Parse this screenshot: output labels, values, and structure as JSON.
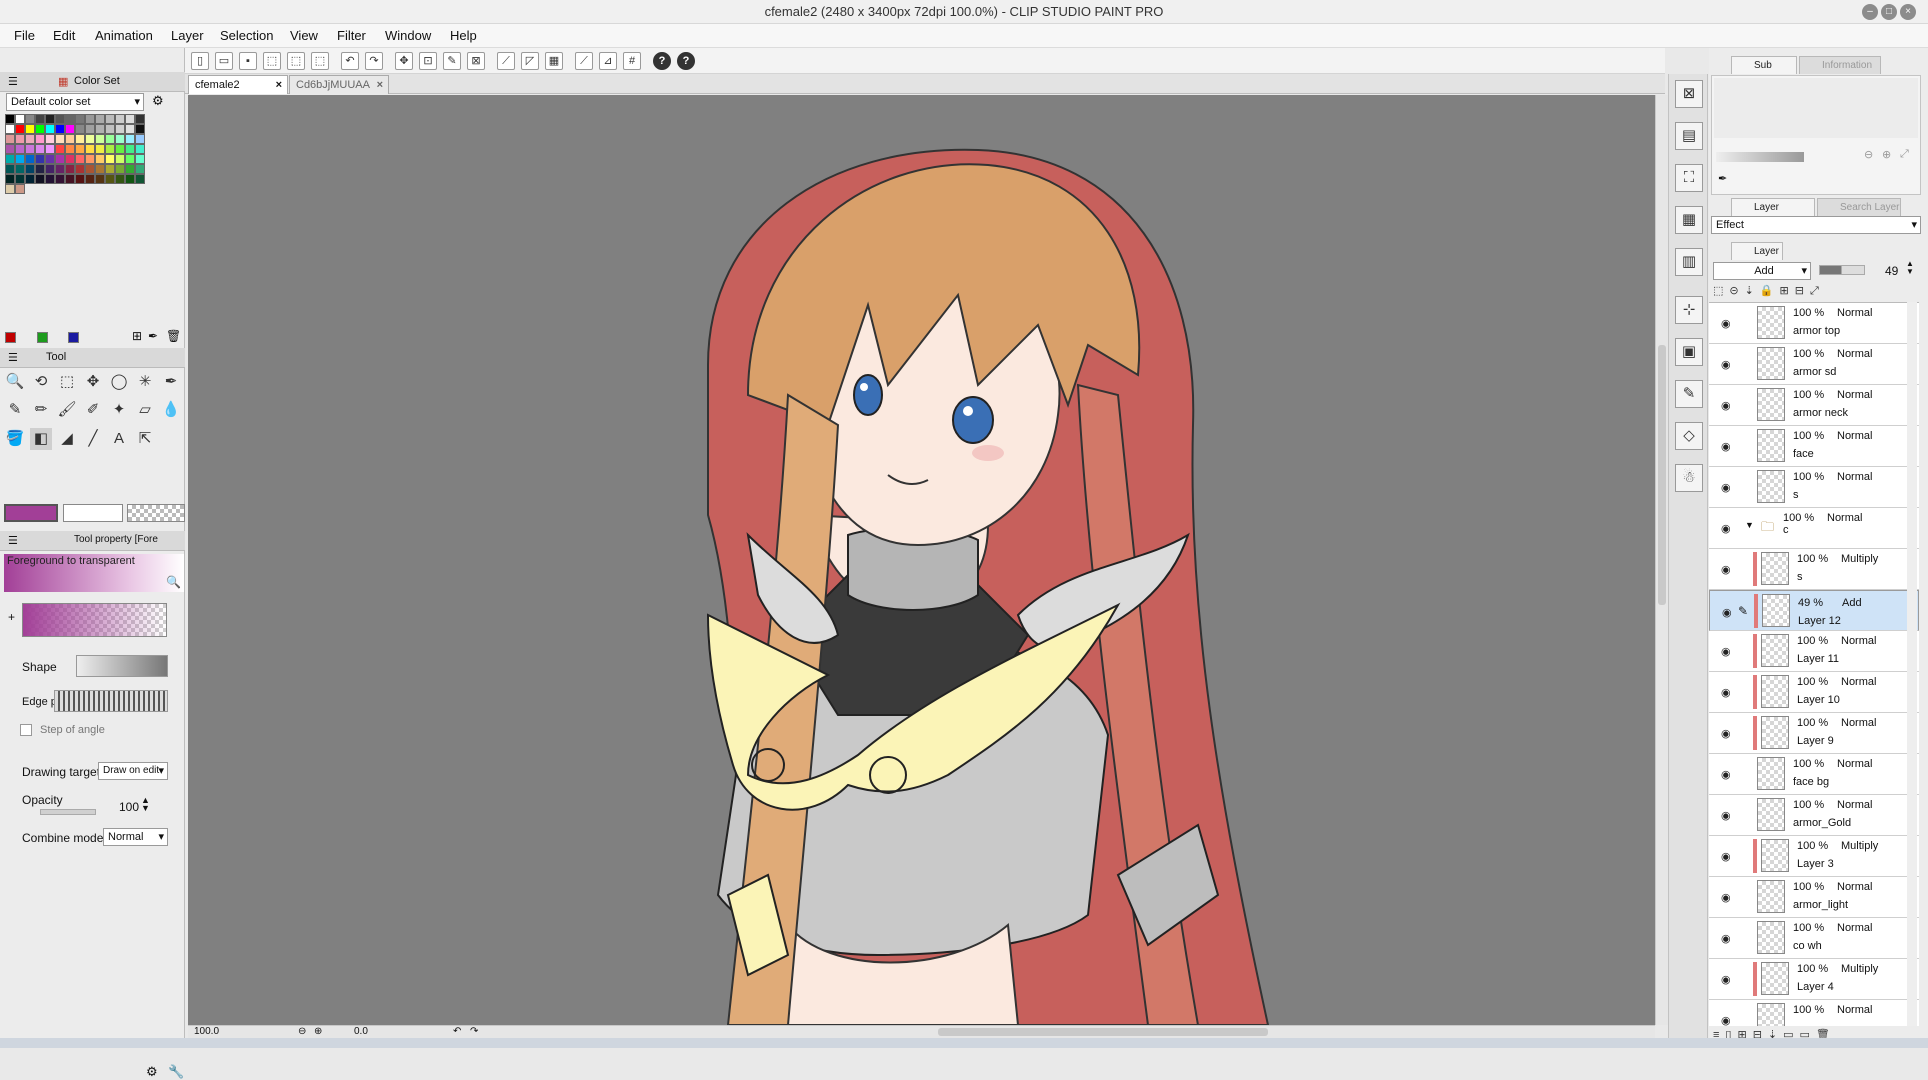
{
  "window": {
    "title": "cfemale2 (2480 x 3400px 72dpi 100.0%)  - CLIP STUDIO PAINT PRO",
    "controls": [
      "minimize-icon",
      "maximize-icon",
      "close-icon"
    ]
  },
  "menu": [
    "File",
    "Edit",
    "Animation",
    "Layer",
    "Selection",
    "View",
    "Filter",
    "Window",
    "Help"
  ],
  "document_tabs": [
    {
      "label": "cfemale2",
      "active": true
    },
    {
      "label": "Cd6bJjMUUAA",
      "active": false
    }
  ],
  "color_set": {
    "panel_title": "Color Set",
    "selected_set": "Default color set"
  },
  "tool_panel": {
    "title": "Tool"
  },
  "tool_property": {
    "title": "Tool property [Fore",
    "gradient_name": "Foreground to transparent",
    "shape_label": "Shape",
    "edge_label": "Edge p",
    "step_of_angle_label": "Step of angle",
    "drawing_target_label": "Drawing target",
    "drawing_target_value": "Draw on edit",
    "opacity_label": "Opacity",
    "opacity_value": "100",
    "combine_mode_label": "Combine mode",
    "combine_mode_value": "Normal"
  },
  "colors": {
    "main_color": "#a23f97",
    "sub_color": "#ffffff",
    "canvas_bg": "#808080"
  },
  "canvas_status": {
    "zoom": "100.0",
    "rotation": "0.0"
  },
  "sub_view": {
    "tab_sub_view": "Sub View",
    "tab_information": "Information"
  },
  "layer_property": {
    "tab_layer_property": "Layer Property",
    "tab_search_layer": "Search Layer",
    "effect_label": "Effect"
  },
  "layer_panel": {
    "tab_layer": "Layer",
    "blend_mode": "Add",
    "opacity": "49",
    "layers": [
      {
        "opacity": "100 %",
        "mode": "Normal",
        "name": "armor top",
        "clip": false,
        "selected": false,
        "indent": 1
      },
      {
        "opacity": "100 %",
        "mode": "Normal",
        "name": "armor sd",
        "clip": false,
        "selected": false,
        "indent": 1
      },
      {
        "opacity": "100 %",
        "mode": "Normal",
        "name": "armor neck",
        "clip": false,
        "selected": false,
        "indent": 1
      },
      {
        "opacity": "100 %",
        "mode": "Normal",
        "name": "face",
        "clip": false,
        "selected": false,
        "indent": 1
      },
      {
        "opacity": "100 %",
        "mode": "Normal",
        "name": "s",
        "clip": false,
        "selected": false,
        "indent": 1
      },
      {
        "opacity": "100 %",
        "mode": "Normal",
        "name": "c",
        "clip": false,
        "selected": false,
        "indent": 0,
        "folder": true
      },
      {
        "opacity": "100 %",
        "mode": "Multiply",
        "name": "s",
        "clip": true,
        "selected": false,
        "indent": 1
      },
      {
        "opacity": "49 %",
        "mode": "Add",
        "name": "Layer 12",
        "clip": true,
        "selected": true,
        "indent": 1
      },
      {
        "opacity": "100 %",
        "mode": "Normal",
        "name": "Layer 11",
        "clip": true,
        "selected": false,
        "indent": 1
      },
      {
        "opacity": "100 %",
        "mode": "Normal",
        "name": "Layer 10",
        "clip": true,
        "selected": false,
        "indent": 1
      },
      {
        "opacity": "100 %",
        "mode": "Normal",
        "name": "Layer 9",
        "clip": true,
        "selected": false,
        "indent": 1
      },
      {
        "opacity": "100 %",
        "mode": "Normal",
        "name": "face bg",
        "clip": false,
        "selected": false,
        "indent": 1
      },
      {
        "opacity": "100 %",
        "mode": "Normal",
        "name": "armor_Gold",
        "clip": false,
        "selected": false,
        "indent": 1
      },
      {
        "opacity": "100 %",
        "mode": "Multiply",
        "name": "Layer 3",
        "clip": true,
        "selected": false,
        "indent": 1
      },
      {
        "opacity": "100 %",
        "mode": "Normal",
        "name": "armor_light",
        "clip": false,
        "selected": false,
        "indent": 1
      },
      {
        "opacity": "100 %",
        "mode": "Normal",
        "name": "co wh",
        "clip": false,
        "selected": false,
        "indent": 1
      },
      {
        "opacity": "100 %",
        "mode": "Multiply",
        "name": "Layer 4",
        "clip": true,
        "selected": false,
        "indent": 1
      },
      {
        "opacity": "100 %",
        "mode": "Normal",
        "name": "",
        "clip": false,
        "selected": false,
        "indent": 1
      }
    ]
  }
}
